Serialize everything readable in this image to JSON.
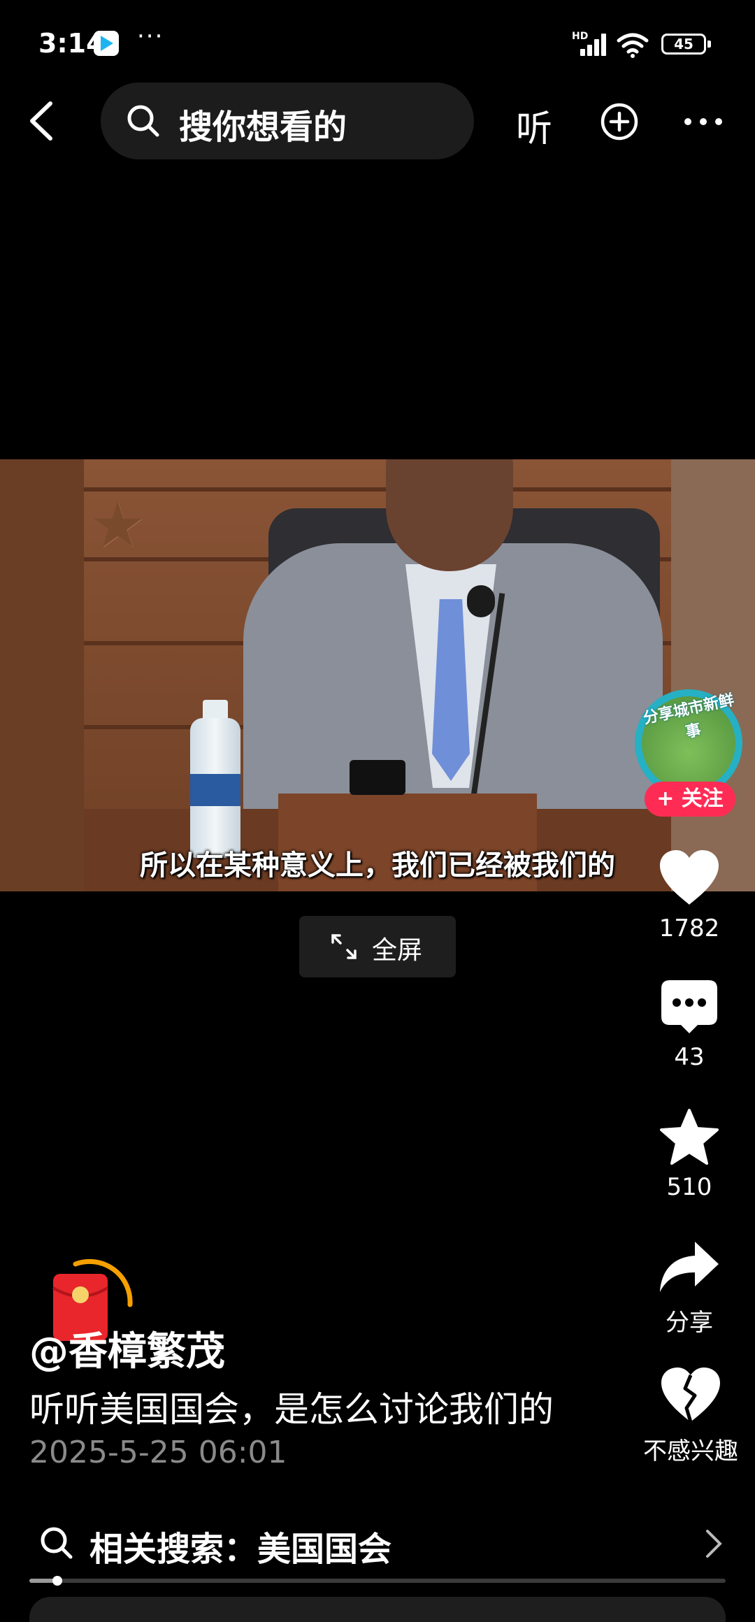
{
  "status_bar": {
    "time": "3:14",
    "dots": "···",
    "network": "HD",
    "battery": "45"
  },
  "top_bar": {
    "search_placeholder": "搜你想看的",
    "listen_label": "听"
  },
  "video": {
    "subtitle": "所以在某种意义上，我们已经被我们的",
    "follow_badge": "分享城市新鲜事",
    "follow_label": "+ 关注",
    "fullscreen_label": "全屏"
  },
  "actions": {
    "like_count": "1782",
    "comment_count": "43",
    "favorite_count": "510",
    "share_label": "分享",
    "not_interested_label": "不感兴趣"
  },
  "post": {
    "author": "@香樟繁茂",
    "description": "听听美国国会，是怎么讨论我们的",
    "date": "2025-5-25 06:01"
  },
  "related_search": {
    "label": "相关搜索：美国国会"
  },
  "playback": {
    "progress_fraction": 0.04
  },
  "colors": {
    "accent": "#fe2c55",
    "background": "#000000",
    "date_gray": "#8a8a8a"
  }
}
